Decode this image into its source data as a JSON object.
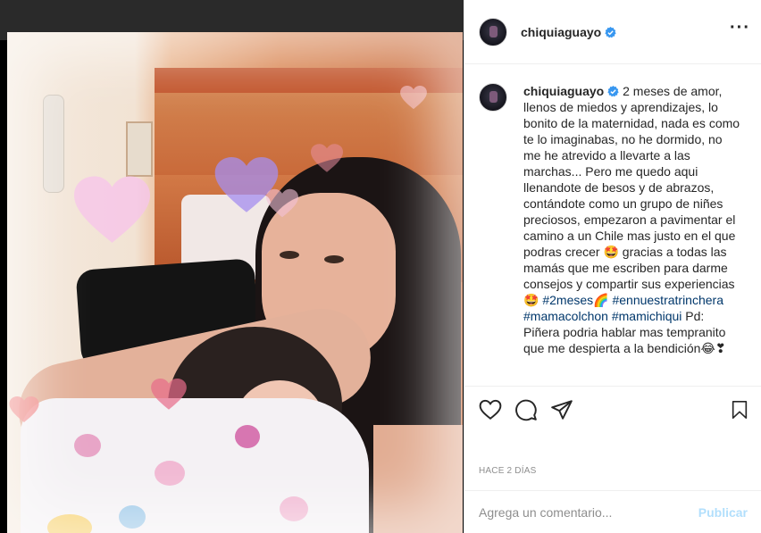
{
  "post": {
    "username": "chiquiaguayo",
    "verified": true,
    "more_icon": "more-horizontal-icon",
    "caption_parts": [
      "2 meses de amor, llenos de miedos y aprendizajes, lo bonito de la maternidad, nada es como te lo imaginabas, no he dormido, no me he atrevido a llevarte a las marchas... Pero me quedo aqui llenandote de besos y de abrazos, contándote como un grupo de niñes preciosos, empezaron a pavimentar el camino a un Chile mas justo en el que podras crecer ",
      "🤩",
      " gracias a todas las mamás que me escriben para darme consejos y compartir sus experiencias ",
      "🤩",
      " ",
      "#2meses",
      "🌈",
      " ",
      "#ennuestratrinchera",
      " ",
      "#mamacolchon",
      " ",
      "#mamichiqui",
      " Pd: Piñera podria hablar mas tempranito que me despierta a la bendición",
      "😂",
      "❣"
    ],
    "timestamp": "Hace 2 días",
    "comment_placeholder": "Agrega un comentario...",
    "post_button": "Publicar"
  },
  "icons": {
    "like": "heart-outline-icon",
    "comment": "comment-bubble-icon",
    "share": "paper-plane-icon",
    "save": "bookmark-icon"
  },
  "colors": {
    "text": "#262626",
    "secondary": "#8e8e8e",
    "verified": "#3897f0",
    "hashtag": "#00376b",
    "post_disabled": "#b2dffc",
    "border": "#efefef"
  }
}
